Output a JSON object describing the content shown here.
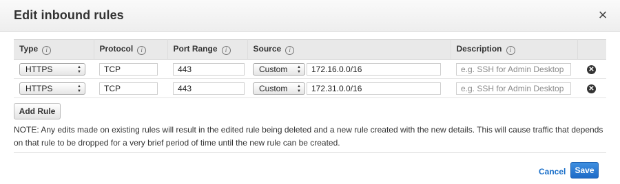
{
  "modal": {
    "title": "Edit inbound rules",
    "close_symbol": "×"
  },
  "columns": [
    {
      "label": "Type",
      "info": "i"
    },
    {
      "label": "Protocol",
      "info": "i"
    },
    {
      "label": "Port Range",
      "info": "i"
    },
    {
      "label": "Source",
      "info": "i"
    },
    {
      "label": "Description",
      "info": "i"
    }
  ],
  "rules": [
    {
      "type": "HTTPS",
      "protocol": "TCP",
      "port_range": "443",
      "source_mode": "Custom",
      "source_cidr": "172.16.0.0/16",
      "description_placeholder": "e.g. SSH for Admin Desktop"
    },
    {
      "type": "HTTPS",
      "protocol": "TCP",
      "port_range": "443",
      "source_mode": "Custom",
      "source_cidr": "172.31.0.0/16",
      "description_placeholder": "e.g. SSH for Admin Desktop"
    }
  ],
  "icons": {
    "select_arrows": "◆",
    "remove": "✕",
    "remove_icon_name": "remove-circle-icon",
    "info_icon_name": "info-icon"
  },
  "add_rule_label": "Add Rule",
  "note": "NOTE: Any edits made on existing rules will result in the edited rule being deleted and a new rule created with the new details. This will cause traffic that depends on that rule to be dropped for a very brief period of time until the new rule can be created.",
  "footer": {
    "cancel_label": "Cancel",
    "save_label": "Save"
  },
  "colors": {
    "accent": "#1d6ac7",
    "link": "#1a6fc9",
    "header_bg": "#e9e9e9"
  }
}
